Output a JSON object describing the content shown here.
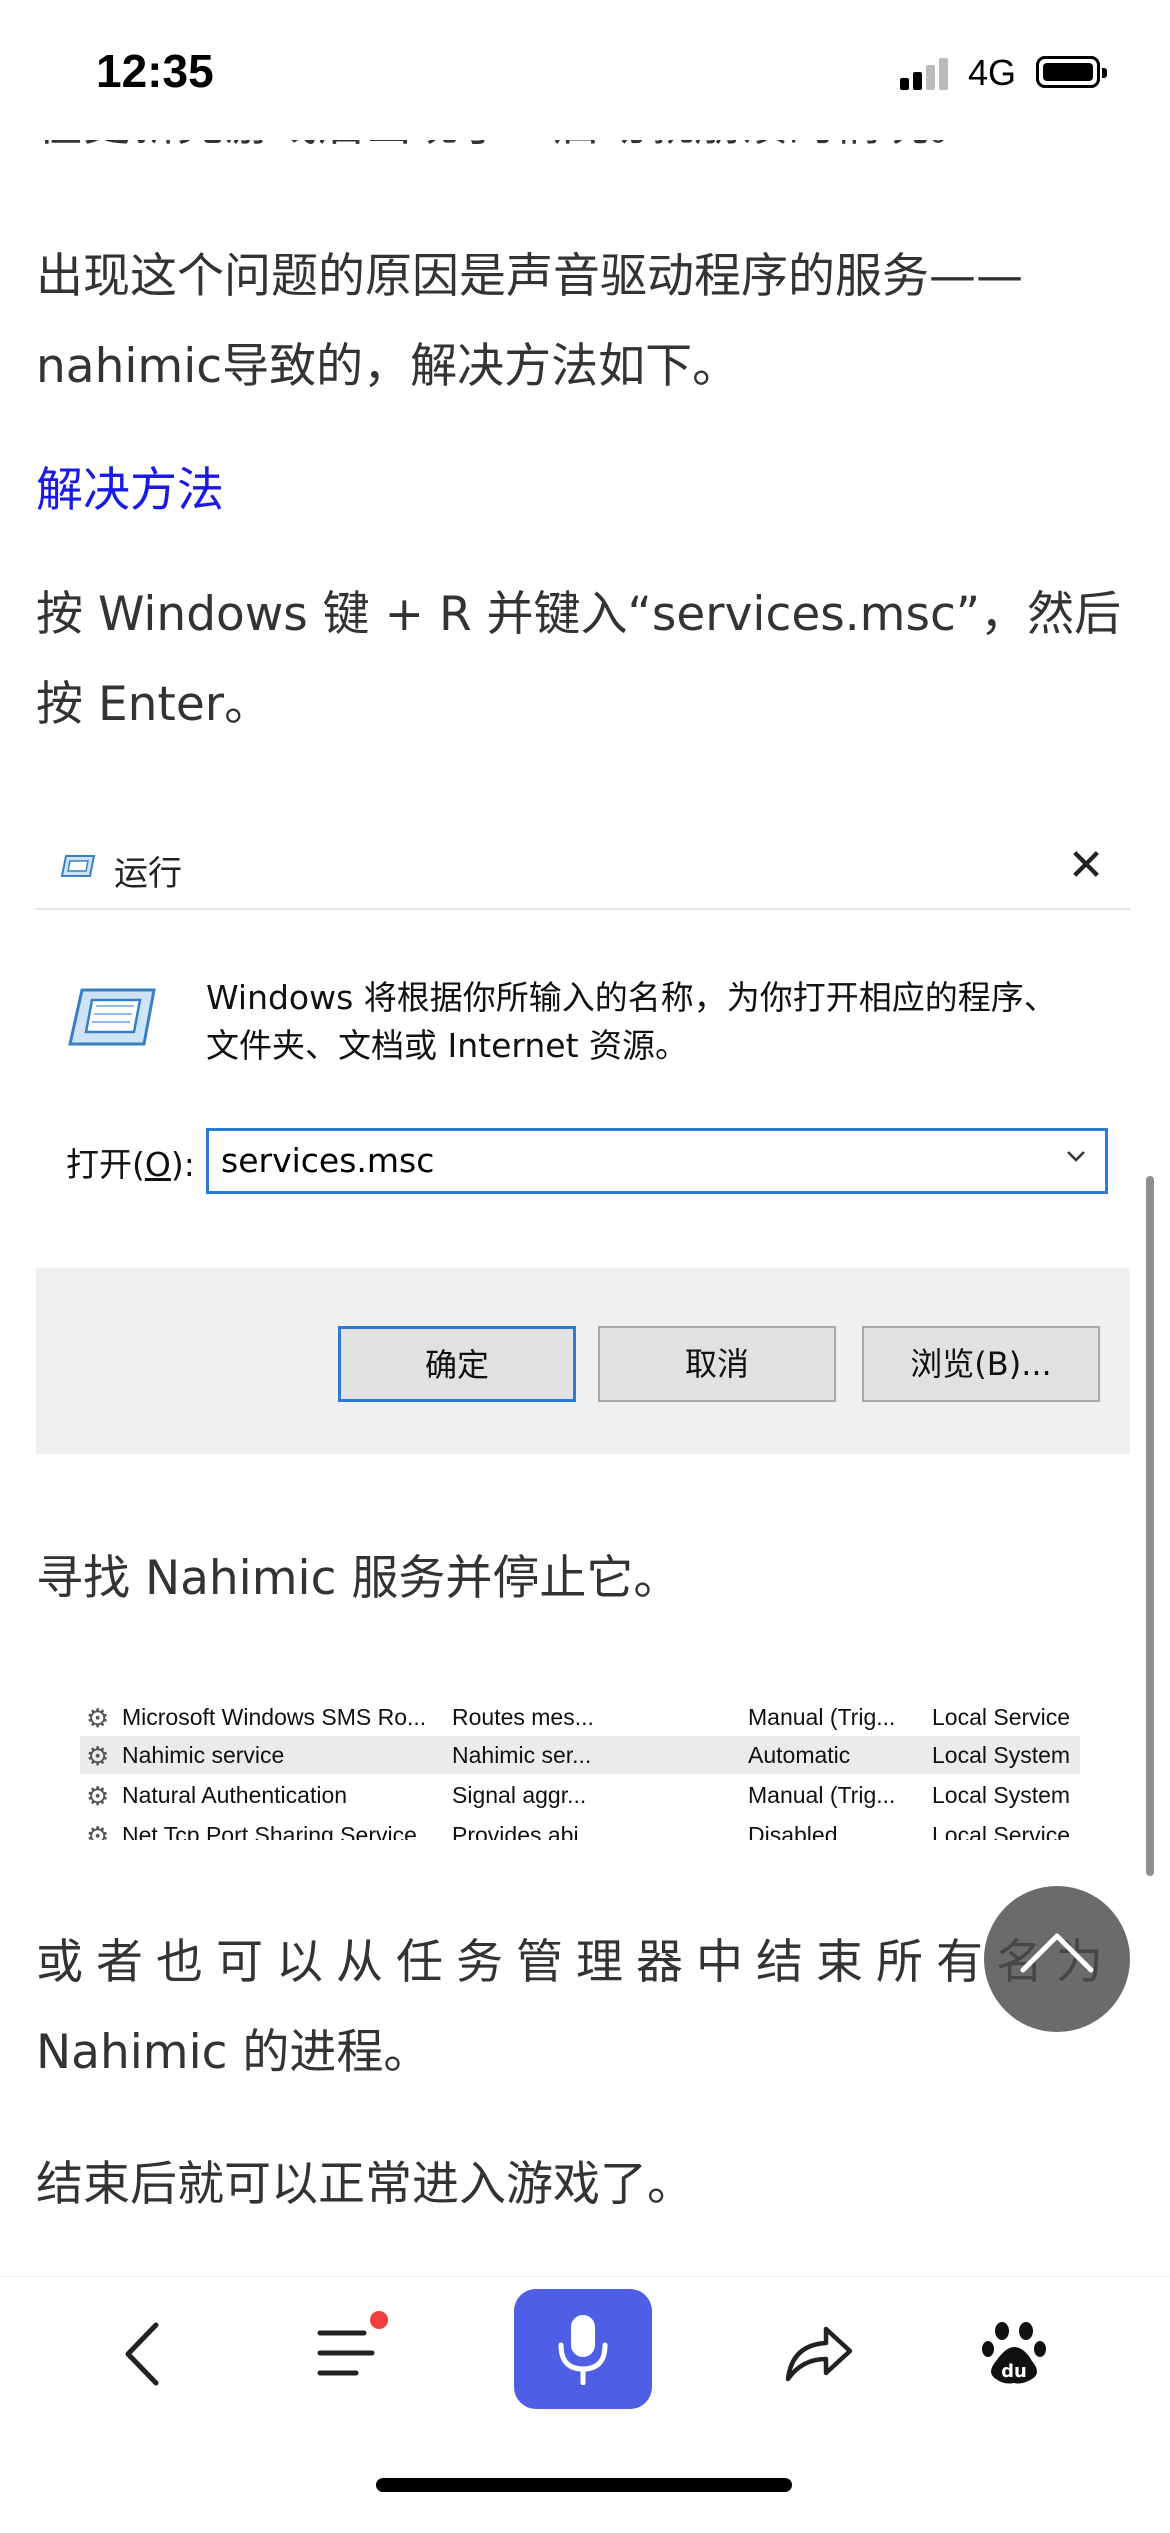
{
  "status_bar": {
    "time": "12:35",
    "network": "4G"
  },
  "article": {
    "cut_line": "在更新完游戏后出现了一启动就崩溃的情况。",
    "para1": [
      "出现这个问题的原因是声音驱动程序的服务——",
      "nahimic导致的，解决方法如下。"
    ],
    "section_link": "解决方法",
    "para2": [
      "按 Windows 键 + R 并键入“services.msc”，然后",
      "按 Enter。"
    ],
    "para3": "寻找 Nahimic 服务并停止它。",
    "para4": [
      "或者也可以从任务管理器中结束所有名为",
      "Nahimic 的进程。"
    ],
    "para5": "结束后就可以正常进入游戏了。"
  },
  "run_dialog": {
    "title": "运行",
    "close_glyph": "✕",
    "description": "Windows 将根据你所输入的名称，为你打开相应的程序、\n文件夹、文档或 Internet 资源。",
    "open_label_prefix": "打开(",
    "open_label_key": "O",
    "open_label_suffix": "):",
    "open_value": "services.msc",
    "ok_label": "确定",
    "cancel_label": "取消",
    "browse_label": "浏览(B)..."
  },
  "services": {
    "rows": [
      {
        "name": "Microsoft Windows SMS Ro...",
        "description": "Routes mes...",
        "startup": "Manual (Trig...",
        "logon": "Local Service"
      },
      {
        "name": "Nahimic service",
        "description": "Nahimic ser...",
        "startup": "Automatic",
        "logon": "Local System"
      },
      {
        "name": "Natural Authentication",
        "description": "Signal aggr...",
        "startup": "Manual (Trig...",
        "logon": "Local System"
      },
      {
        "name": "Net Tcp Port Sharing Service",
        "description": "Provides abi...",
        "startup": "Disabled",
        "logon": "Local Service"
      }
    ]
  },
  "bottom_nav": {
    "items": [
      "back-icon",
      "menu-icon",
      "microphone-icon",
      "share-icon",
      "baidu-paw-icon"
    ],
    "accent": "#4e5fe5",
    "badge_color": "#f23d3d"
  }
}
